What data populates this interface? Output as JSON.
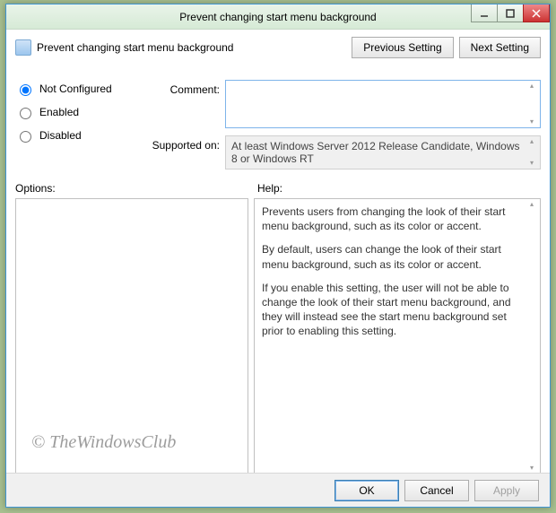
{
  "window": {
    "title": "Prevent changing start menu background"
  },
  "header": {
    "policy_name": "Prevent changing start menu background",
    "previous_label": "Previous Setting",
    "next_label": "Next Setting"
  },
  "radios": {
    "not_configured": "Not Configured",
    "enabled": "Enabled",
    "disabled": "Disabled"
  },
  "fields": {
    "comment_label": "Comment:",
    "supported_label": "Supported on:",
    "supported_value": "At least Windows Server 2012 Release Candidate, Windows 8 or Windows RT"
  },
  "panes": {
    "options_label": "Options:",
    "help_label": "Help:",
    "help_p1": "Prevents users from changing the look of their start menu background, such as its color or accent.",
    "help_p2": "By default, users can change the look of their start menu background, such as its color or accent.",
    "help_p3": "If you enable this setting, the user will not be able to change the look of their start menu background, and they will instead see the start menu background set prior to enabling this setting."
  },
  "footer": {
    "ok": "OK",
    "cancel": "Cancel",
    "apply": "Apply"
  },
  "watermark": "© TheWindowsClub"
}
